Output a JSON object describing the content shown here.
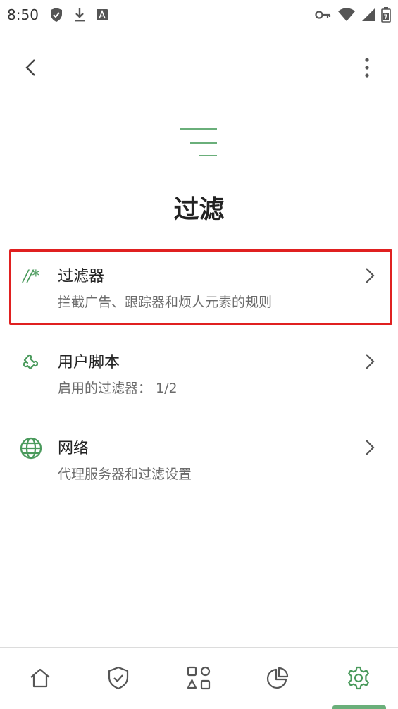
{
  "status_bar": {
    "time": "8:50",
    "left_icons": [
      "shield-check-icon",
      "download-icon",
      "font-a-icon"
    ],
    "right_icons": [
      "key-icon",
      "wifi-icon",
      "signal-icon",
      "battery-icon"
    ]
  },
  "top_bar": {
    "back_icon": "chevron-left-icon",
    "menu_icon": "more-vertical-icon"
  },
  "page": {
    "title": "过滤",
    "icon": "filter-lines-icon"
  },
  "items": [
    {
      "icon": "rules-icon",
      "icon_text": "//*",
      "title": "过滤器",
      "subtitle": "拦截广告、跟踪器和烦人元素的规则",
      "highlighted": true
    },
    {
      "icon": "puzzle-icon",
      "title": "用户脚本",
      "subtitle": "启用的过滤器： 1/2",
      "highlighted": false
    },
    {
      "icon": "globe-icon",
      "title": "网络",
      "subtitle": "代理服务器和过滤设置",
      "highlighted": false
    }
  ],
  "bottom_nav": {
    "items": [
      "home-icon",
      "shield-icon",
      "apps-icon",
      "chart-icon",
      "settings-icon"
    ],
    "active_index": 4
  },
  "colors": {
    "accent": "#4a9a5c",
    "highlight_border": "#e02020",
    "text_primary": "#222222",
    "text_secondary": "#6b6b6b"
  }
}
